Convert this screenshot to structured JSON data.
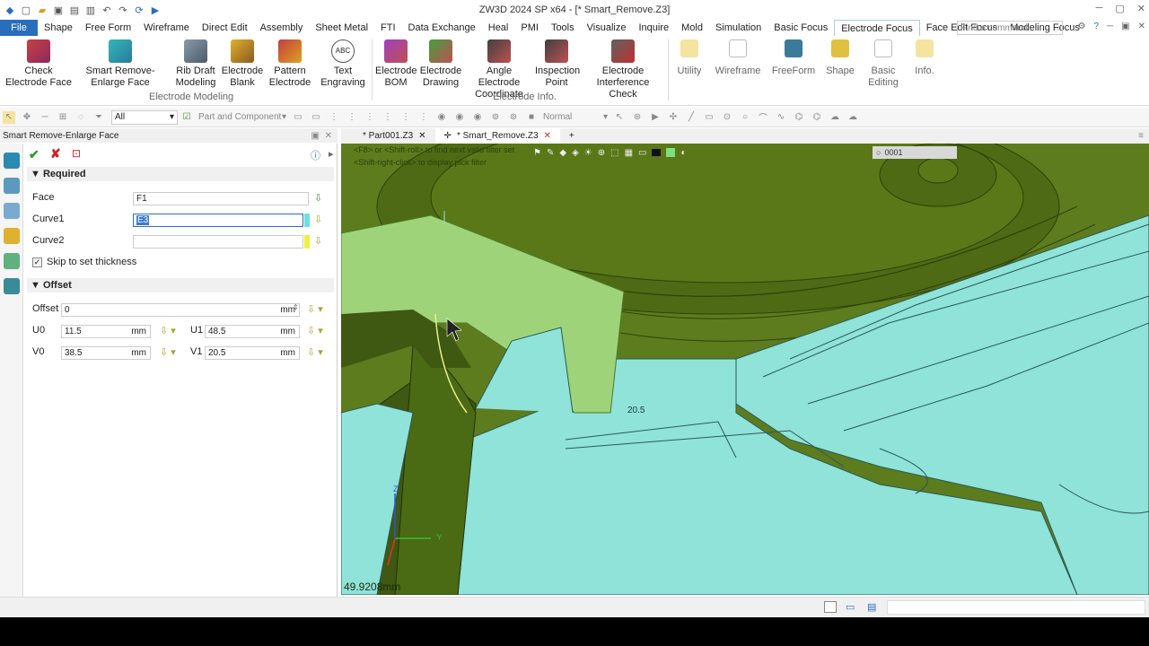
{
  "app": {
    "title": "ZW3D 2024 SP x64 - [* Smart_Remove.Z3]"
  },
  "menu": {
    "file": "File",
    "items": [
      "Shape",
      "Free Form",
      "Wireframe",
      "Direct Edit",
      "Assembly",
      "Sheet Metal",
      "FTI",
      "Data Exchange",
      "Heal",
      "PMI",
      "Tools",
      "Visualize",
      "Inquire",
      "Mold",
      "Simulation",
      "Basic Focus",
      "Electrode Focus",
      "Face Edit Focus",
      "Modeling Focus"
    ],
    "active": "Electrode Focus",
    "search_placeholder": "Find a command"
  },
  "ribbon": {
    "buttons": [
      {
        "label": "Check Electrode Face"
      },
      {
        "label": "Smart Remove-Enlarge Face"
      },
      {
        "label": "Rib Draft Modeling"
      },
      {
        "label": "Electrode Blank"
      },
      {
        "label": "Pattern Electrode"
      },
      {
        "label": "Text Engraving"
      },
      {
        "label": "Electrode BOM"
      },
      {
        "label": "Electrode Drawing"
      },
      {
        "label": "Angle Electrode Coordinate"
      },
      {
        "label": "Inspection Point"
      },
      {
        "label": "Electrode Interference Check"
      },
      {
        "label": "Utility"
      },
      {
        "label": "Wireframe"
      },
      {
        "label": "FreeForm"
      },
      {
        "label": "Shape"
      },
      {
        "label": "Basic Editing"
      },
      {
        "label": "Info."
      }
    ],
    "groups": {
      "modeling": "Electrode Modeling",
      "info": "Electrode Info."
    }
  },
  "toolbar2": {
    "filter": "All",
    "pick": "Part and Component",
    "mode": "Normal"
  },
  "panel": {
    "title": "Smart Remove-Enlarge Face",
    "required": "Required",
    "face_label": "Face",
    "face_value": "F1",
    "curve1_label": "Curve1",
    "curve1_value": "E3",
    "curve2_label": "Curve2",
    "curve2_value": "",
    "skip_label": "Skip to set thickness",
    "offset_section": "Offset",
    "offset_label": "Offset",
    "offset_value": "0",
    "unit": "mm",
    "u0_label": "U0",
    "u0_value": "11.5",
    "u1_label": "U1",
    "u1_value": "48.5",
    "v0_label": "V0",
    "v0_value": "38.5",
    "v1_label": "V1",
    "v1_value": "20.5"
  },
  "tabs": [
    {
      "label": "* Part001.Z3"
    },
    {
      "label": "* Smart_Remove.Z3"
    }
  ],
  "viewport": {
    "hint1": "<F8> or <Shift-roll> to find next valid filter set",
    "hint2": "<Shift-right-click> to display pick filter",
    "layer": "0001",
    "dim_label": "20.5",
    "measure": "49.9208mm",
    "axis_y": "Y",
    "axis_z": "Z"
  },
  "colors": {
    "accent": "#2a6ebb",
    "part_dark": "#5a7a1a",
    "part_cyan": "#8fe3d9",
    "preview": "#9ed37a"
  }
}
